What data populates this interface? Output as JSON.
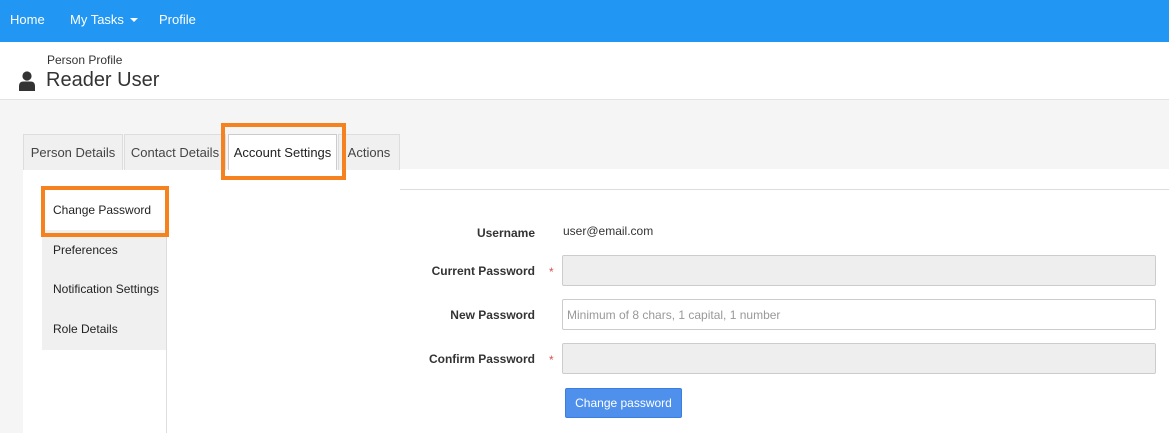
{
  "navbar": {
    "items": [
      {
        "label": "Home"
      },
      {
        "label": "My Tasks"
      },
      {
        "label": "Profile"
      }
    ]
  },
  "header": {
    "breadcrumb": "Person Profile",
    "title": "Reader User"
  },
  "tabs": [
    {
      "label": "Person Details"
    },
    {
      "label": "Contact Details"
    },
    {
      "label": "Account Settings",
      "active": true
    },
    {
      "label": "Actions"
    }
  ],
  "side_menu": [
    {
      "label": "Change Password",
      "active": true
    },
    {
      "label": "Preferences"
    },
    {
      "label": "Notification Settings"
    },
    {
      "label": "Role Details"
    }
  ],
  "form": {
    "username_label": "Username",
    "username_value": "user@email.com",
    "current_password_label": "Current Password",
    "current_password_value": "",
    "new_password_label": "New Password",
    "new_password_placeholder": "Minimum of 8 chars, 1 capital, 1 number",
    "confirm_password_label": "Confirm Password",
    "confirm_password_value": "",
    "required_marker": "*",
    "submit_label": "Change password"
  },
  "colors": {
    "navbar": "#2196f3",
    "highlight": "#f5821f",
    "button": "#4e90ec",
    "required": "#d9534f"
  }
}
